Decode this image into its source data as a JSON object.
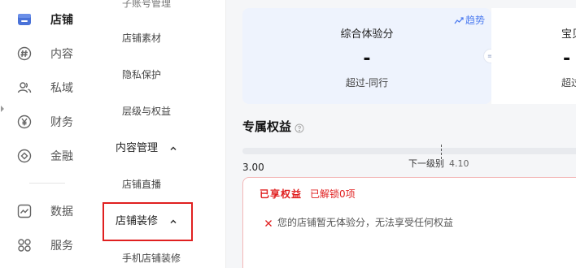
{
  "rail": {
    "items": [
      {
        "label": "店铺",
        "icon": "store-icon",
        "active": true
      },
      {
        "label": "内容",
        "icon": "hashtag-icon",
        "active": false
      },
      {
        "label": "私域",
        "icon": "users-icon",
        "active": false
      },
      {
        "label": "财务",
        "icon": "yen-icon",
        "active": false
      },
      {
        "label": "金融",
        "icon": "circle-target-icon",
        "active": false
      },
      {
        "label": "数据",
        "icon": "chart-line-icon",
        "active": false
      },
      {
        "label": "服务",
        "icon": "grid-icon",
        "active": false
      }
    ]
  },
  "submenu": {
    "top_cut": "子账号管理",
    "items": [
      {
        "label": "店铺素材"
      },
      {
        "label": "隐私保护"
      },
      {
        "label": "层级与权益"
      }
    ],
    "group_content": "内容管理",
    "content_items": [
      {
        "label": "店铺直播"
      }
    ],
    "group_decor": "店铺装修",
    "decor_items": [
      {
        "label": "手机店铺装修"
      }
    ]
  },
  "main": {
    "trend_label": "趋势",
    "score_card": {
      "title": "综合体验分",
      "value": "-",
      "subtitle": "超过-同行"
    },
    "score_card2": {
      "title": "宝贝",
      "value": "-",
      "subtitle": "超过"
    },
    "eq_symbol": "=",
    "section_title": "专属权益",
    "progress": {
      "current": "3.00",
      "next_label": "下一级别",
      "next_value": "4.10",
      "fraction": 0
    },
    "benefits": {
      "title": "已享权益",
      "count": "已解锁0项",
      "message": "您的店铺暂无体验分，无法享受任何权益"
    }
  },
  "colors": {
    "accent": "#4d7cf0",
    "danger": "#e02020"
  }
}
